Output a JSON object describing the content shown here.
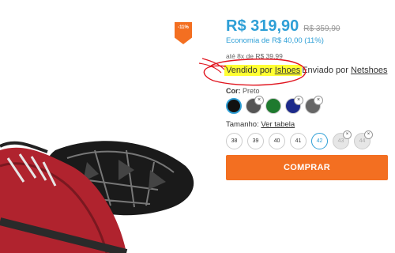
{
  "badge": {
    "discount": "-11%"
  },
  "price": {
    "current": "R$ 319,90",
    "old": "R$ 359,90",
    "savings": "Economia de R$ 40,00 (11%)",
    "installments": "até 8x de R$ 39,99"
  },
  "seller": {
    "sold_by_label": "Vendido por ",
    "sold_by_name": "Ishoes",
    "shipped_by_label": "Enviado por ",
    "shipped_by_name": "Netshoes"
  },
  "color": {
    "label": "Cor:",
    "selected": "Preto",
    "options": [
      {
        "hex": "#111111",
        "selected": true,
        "available": true
      },
      {
        "hex": "#555555",
        "selected": false,
        "available": false
      },
      {
        "hex": "#1e7a2e",
        "selected": false,
        "available": true
      },
      {
        "hex": "#1c2a8a",
        "selected": false,
        "available": false
      },
      {
        "hex": "#666666",
        "selected": false,
        "available": false
      }
    ]
  },
  "size": {
    "label": "Tamanho:",
    "chart_link": "Ver tabela",
    "options": [
      {
        "value": "38",
        "selected": false,
        "available": true
      },
      {
        "value": "39",
        "selected": false,
        "available": true
      },
      {
        "value": "40",
        "selected": false,
        "available": true
      },
      {
        "value": "41",
        "selected": false,
        "available": true
      },
      {
        "value": "42",
        "selected": true,
        "available": true
      },
      {
        "value": "43",
        "selected": false,
        "available": false
      },
      {
        "value": "44",
        "selected": false,
        "available": false
      }
    ]
  },
  "buy_button": {
    "label": "COMPRAR"
  },
  "colors": {
    "accent": "#2e9fd6",
    "buy": "#f36f21",
    "highlight": "#ffff33",
    "annotation": "#e0141e"
  }
}
